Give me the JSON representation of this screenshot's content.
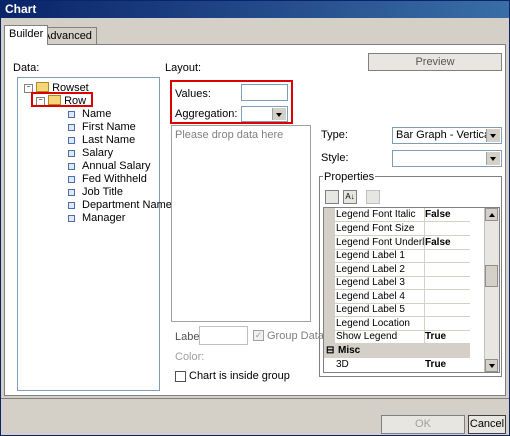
{
  "window": {
    "title": "Chart"
  },
  "tabs": [
    {
      "label": "Builder"
    },
    {
      "label": "Advanced"
    }
  ],
  "data_panel": {
    "label": "Data:",
    "tree": {
      "root": "Rowset",
      "child": "Row",
      "fields": [
        "Name",
        "First Name",
        "Last Name",
        "Salary",
        "Annual Salary",
        "Fed Withheld",
        "Job Title",
        "Department Name",
        "Manager"
      ]
    }
  },
  "layout": {
    "label": "Layout:",
    "preview_label": "Preview",
    "values_label": "Values:",
    "aggregation_label": "Aggregation:",
    "drop_placeholder": "Please drop data here",
    "labe_label": "Labe",
    "group_data_label": "Group Data",
    "color_label": "Color:",
    "inside_group_label": "Chart is inside group"
  },
  "settings": {
    "type_label": "Type:",
    "type_value": "Bar Graph - Vertical",
    "style_label": "Style:",
    "style_value": ""
  },
  "properties": {
    "label": "Properties",
    "rows": [
      {
        "name": "Legend Font Italic",
        "value": "False"
      },
      {
        "name": "Legend Font Size",
        "value": ""
      },
      {
        "name": "Legend Font Underline",
        "value": "False"
      },
      {
        "name": "Legend Label 1",
        "value": ""
      },
      {
        "name": "Legend Label 2",
        "value": ""
      },
      {
        "name": "Legend Label 3",
        "value": ""
      },
      {
        "name": "Legend Label 4",
        "value": ""
      },
      {
        "name": "Legend Label 5",
        "value": ""
      },
      {
        "name": "Legend Location",
        "value": ""
      },
      {
        "name": "Show Legend",
        "value": "True"
      }
    ],
    "category": {
      "name": "Misc",
      "toggle": "⊟"
    },
    "misc_rows": [
      {
        "name": "3D",
        "value": "True"
      }
    ]
  },
  "footer": {
    "ok_label": "OK",
    "cancel_label": "Cancel"
  }
}
